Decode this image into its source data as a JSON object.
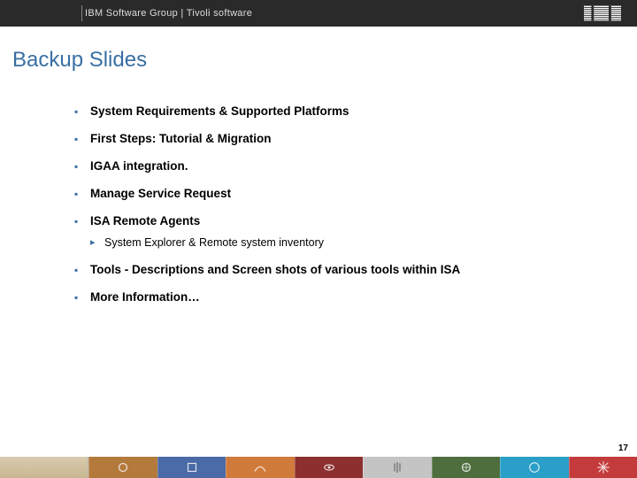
{
  "header": {
    "breadcrumb": "IBM Software Group | Tivoli software",
    "logo_label": "IBM"
  },
  "title": "Backup Slides",
  "bullets": [
    {
      "text": "System Requirements & Supported Platforms"
    },
    {
      "text": "First Steps:  Tutorial & Migration"
    },
    {
      "text": "IGAA integration."
    },
    {
      "text": "Manage Service Request"
    },
    {
      "text": "ISA Remote Agents",
      "sub": [
        {
          "text": "System Explorer & Remote system inventory"
        }
      ]
    },
    {
      "text": "Tools  - Descriptions and Screen shots of various tools within ISA"
    },
    {
      "text": "More Information…"
    }
  ],
  "page_number": "17"
}
